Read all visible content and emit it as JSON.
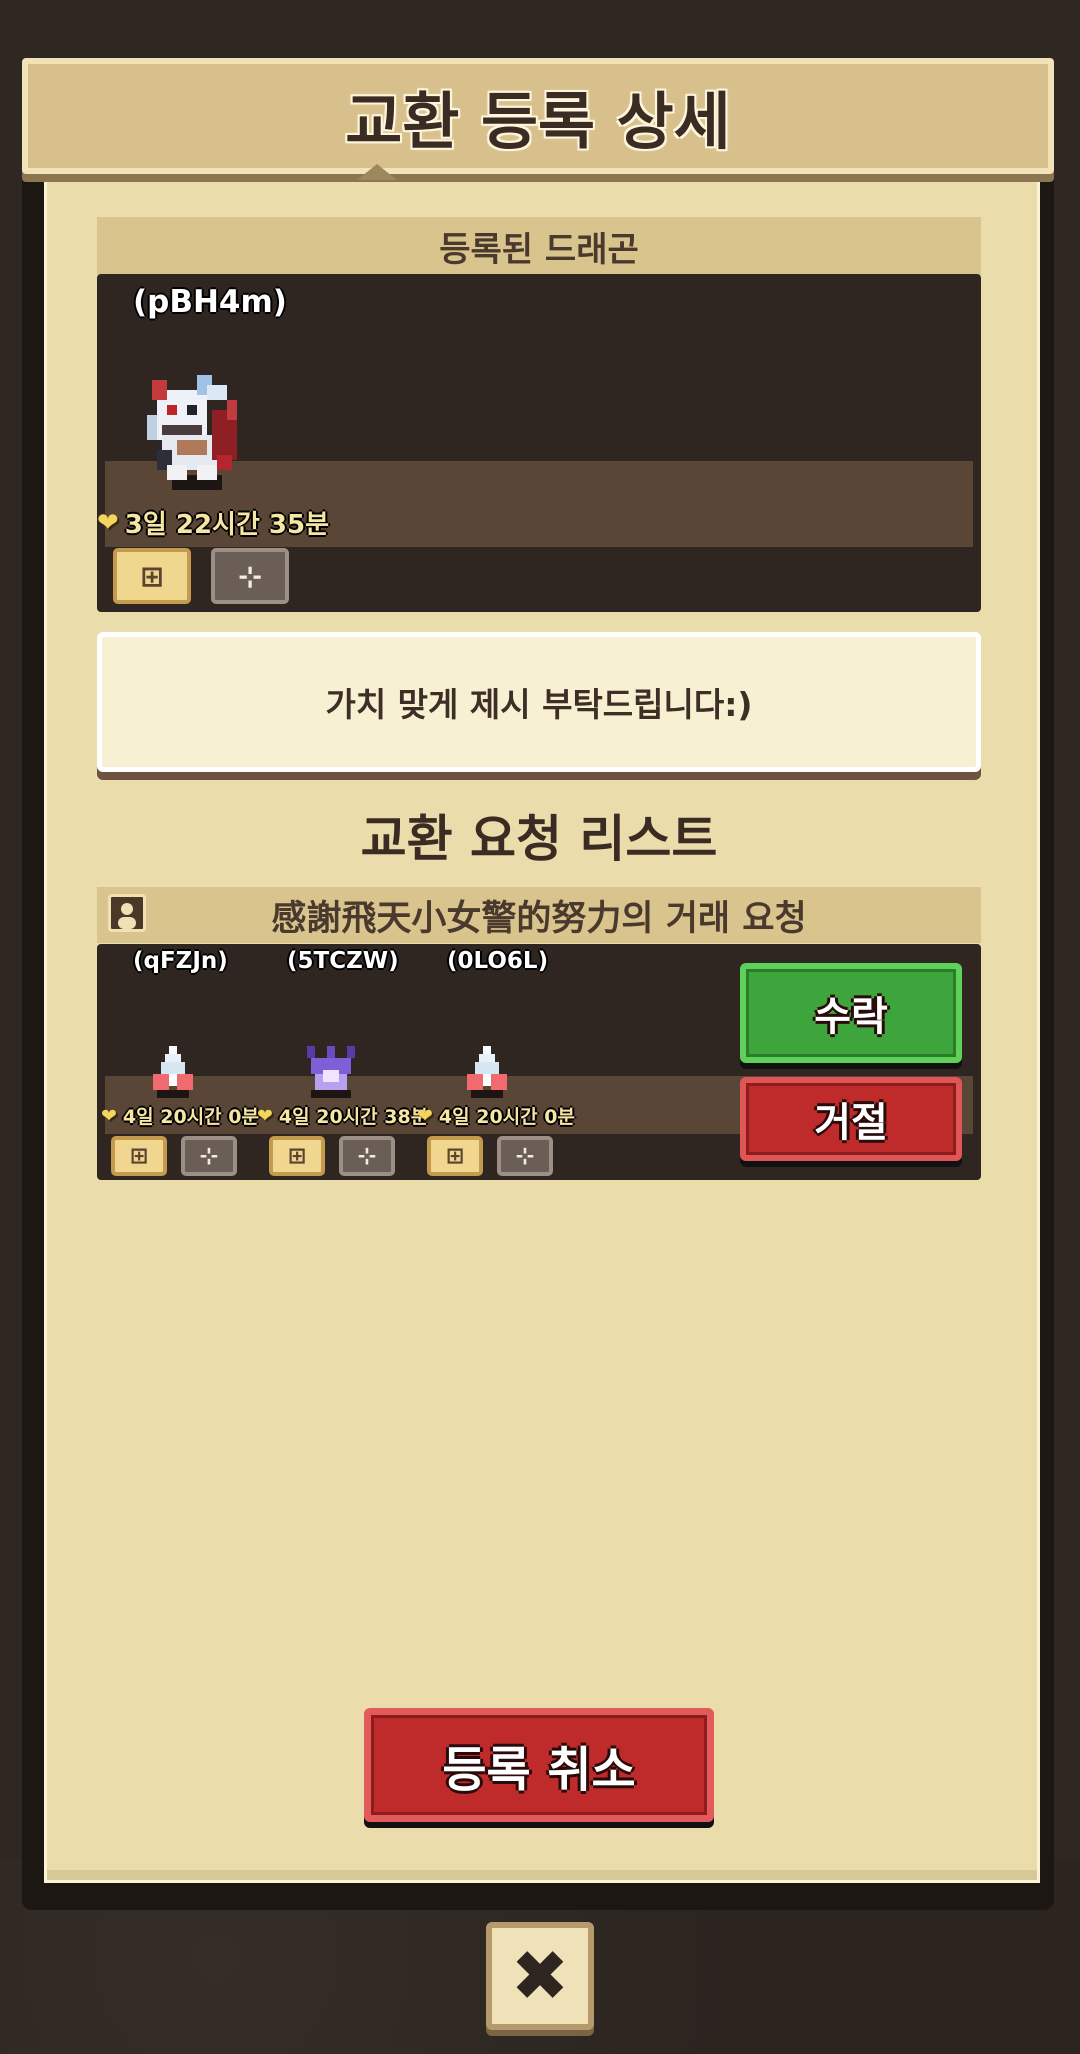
{
  "header": {
    "title": "교환 등록 상세"
  },
  "registered": {
    "section_label": "등록된 드래곤",
    "nickname": "(pBH4m)",
    "timer": "3일 22시간 35분",
    "slot_icons": [
      "tree-icon",
      "target-icon"
    ]
  },
  "memo": {
    "text": "가치 맞게 제시 부탁드립니다:)"
  },
  "requests": {
    "list_title": "교환 요청 리스트",
    "request": {
      "header_label": "感謝飛天小女警的努力의 거래 요청",
      "dragons": [
        {
          "nickname": "(qFZJn)",
          "timer": "4일 20시간 0분",
          "egg_color": "white-red"
        },
        {
          "nickname": "(5TCZW)",
          "timer": "4일 20시간 38분",
          "egg_color": "purple"
        },
        {
          "nickname": "(0LO6L)",
          "timer": "4일 20시간 0분",
          "egg_color": "white-red"
        }
      ],
      "accept_label": "수락",
      "reject_label": "거절"
    }
  },
  "footer": {
    "cancel_label": "등록 취소",
    "close_glyph": "✖"
  },
  "colors": {
    "accept": "#3da53b",
    "reject": "#bf2a2a",
    "panel": "#ebdcac",
    "header_bar": "#d7c08b"
  }
}
